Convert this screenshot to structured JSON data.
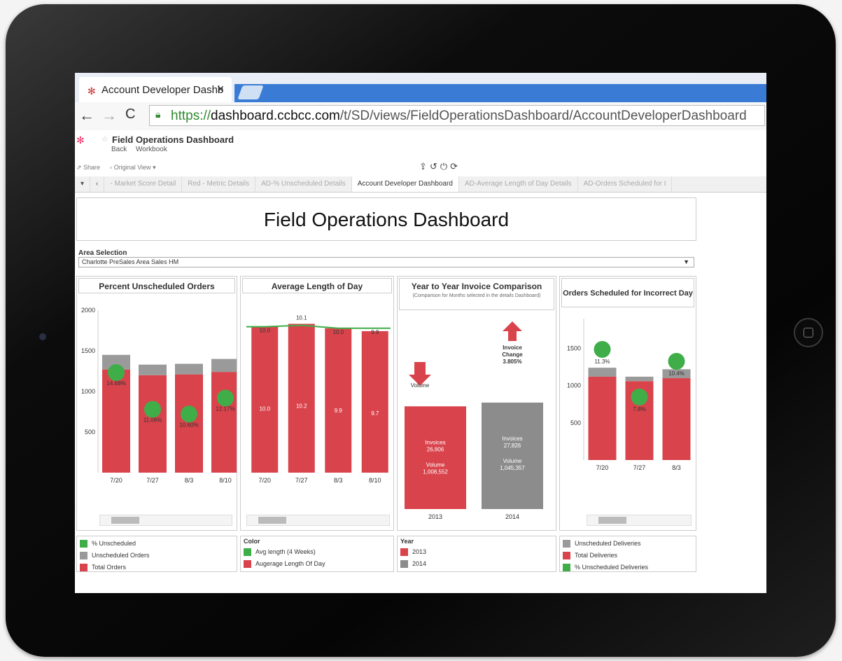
{
  "browser": {
    "tab_title": "Account Developer Dashb",
    "url_scheme": "https://",
    "url_domain": "dashboard.ccbcc.com",
    "url_path": "/t/SD/views/FieldOperationsDashboard/AccountDeveloperDashboard"
  },
  "workbook": {
    "title": "Field Operations Dashboard",
    "back_label": "Back",
    "workbook_label": "Workbook",
    "share_label": "Share",
    "original_view_label": "Original View"
  },
  "sheets": [
    "- Market Score Detail",
    "Red - Metric Details",
    "AD-% Unscheduled Details",
    "Account Developer Dashboard",
    "AD-Average Length of Day Details",
    "AD-Orders Scheduled for I"
  ],
  "dashboard": {
    "title": "Field Operations Dashboard",
    "area_label": "Area Selection",
    "area_value": "Charlotte PreSales Area Sales HM"
  },
  "chart_data": [
    {
      "type": "bar",
      "title": "Percent Unscheduled Orders",
      "categories": [
        "7/20",
        "7/27",
        "8/3",
        "8/10"
      ],
      "ylim": [
        0,
        2000
      ],
      "yticks": [
        "2000",
        "1500",
        "1000",
        "500"
      ],
      "series": [
        {
          "name": "Total Orders",
          "values": [
            1270,
            1200,
            1210,
            1240
          ],
          "color": "#d9434b"
        },
        {
          "name": "Unscheduled Orders",
          "values": [
            180,
            130,
            130,
            160
          ],
          "color": "#9a9a9a"
        },
        {
          "name": "% Unscheduled",
          "values": [
            14.68,
            11.06,
            10.6,
            12.17
          ],
          "labels": [
            "14.68%",
            "11.06%",
            "10.60%",
            "12.17%"
          ],
          "color": "#3fae49"
        }
      ]
    },
    {
      "type": "bar",
      "title": "Average Length of Day",
      "categories": [
        "7/20",
        "7/27",
        "8/3",
        "8/10"
      ],
      "ylim": [
        0,
        12
      ],
      "series": [
        {
          "name": "Augerage Length Of Day",
          "values": [
            10.0,
            10.2,
            9.9,
            9.7
          ],
          "labels": [
            "10.0",
            "10.2",
            "9.9",
            "9.7"
          ],
          "color": "#d9434b"
        },
        {
          "name": "Avg length (4 Weeks)",
          "values": [
            10.0,
            10.1,
            9.9,
            9.9
          ],
          "labels": [
            "10.0",
            "10.1",
            "10.0",
            "9.9"
          ],
          "color": "#3fae49"
        }
      ]
    },
    {
      "type": "bar",
      "title": "Year to Year Invoice Comparison",
      "subtitle": "(Comparison for Months selected in the details Dashboard)",
      "categories": [
        "2013",
        "2014"
      ],
      "series": [
        {
          "name": "Invoices",
          "values": [
            26806,
            27826
          ],
          "labels": [
            "26,806",
            "27,826"
          ]
        },
        {
          "name": "Volume",
          "values": [
            1008552,
            1045357
          ],
          "labels": [
            "1,008,552",
            "1,045,357"
          ]
        }
      ],
      "colors": [
        "#d9434b",
        "#8c8c8c"
      ],
      "annotations": {
        "volume_label": "Volume",
        "invoice_change_label": "Invoice\nChange\n3.805%"
      }
    },
    {
      "type": "bar",
      "title": "Orders Scheduled for Incorrect Day",
      "categories": [
        "7/20",
        "7/27",
        "8/3"
      ],
      "ylim": [
        0,
        1900
      ],
      "yticks": [
        "1500",
        "1000",
        "500"
      ],
      "series": [
        {
          "name": "Total Deliveries",
          "values": [
            1120,
            1060,
            1100
          ],
          "color": "#d9434b"
        },
        {
          "name": "Unscheduled Deliveries",
          "values": [
            120,
            60,
            120
          ],
          "color": "#9a9a9a"
        },
        {
          "name": "% Unscheduled Deliveries",
          "values": [
            11.3,
            7.8,
            10.4
          ],
          "labels": [
            "11.3%",
            "7.8%",
            "10.4%"
          ],
          "color": "#3fae49"
        }
      ]
    }
  ],
  "legends": {
    "unscheduled": [
      "% Unscheduled",
      "Unscheduled Orders",
      "Total Orders"
    ],
    "length_head": "Color",
    "length": [
      "Avg length (4 Weeks)",
      "Augerage Length Of Day"
    ],
    "year_head": "Year",
    "year": [
      "2013",
      "2014"
    ],
    "incorrect": [
      "Unscheduled Deliveries",
      "Total Deliveries",
      "% Unscheduled Deliveries"
    ]
  },
  "colors": {
    "red": "#d9434b",
    "gray": "#9a9a9a",
    "green": "#3fae49",
    "chrome_blue": "#3a7bd5"
  }
}
